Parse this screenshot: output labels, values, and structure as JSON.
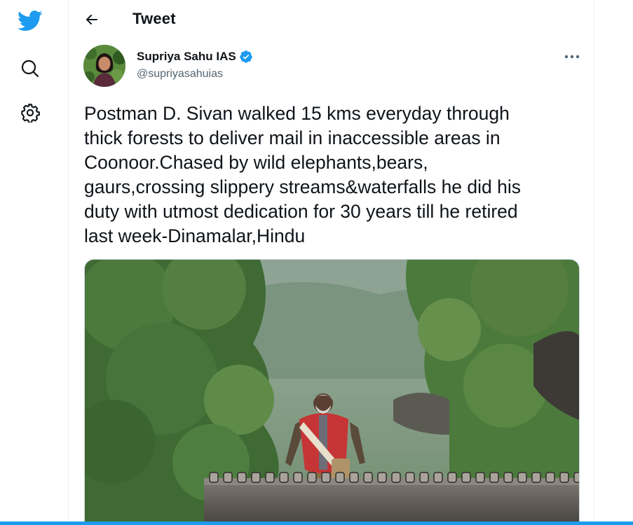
{
  "header": {
    "title": "Tweet"
  },
  "author": {
    "name": "Supriya Sahu IAS",
    "handle": "@supriyasahuias"
  },
  "tweet": {
    "text": "Postman D. Sivan walked 15 kms everyday through\nthick forests to deliver mail in inaccessible areas in\nCoonoor.Chased by wild elephants,bears,\ngaurs,crossing slippery streams&waterfalls he did his\nduty with utmost dedication for 30 years till he retired\nlast week-Dinamalar,Hindu"
  },
  "icons": {
    "logo": "twitter-bird-icon",
    "search": "search-icon",
    "settings": "gear-icon",
    "back": "arrow-left-icon",
    "verified": "verified-badge-icon",
    "more": "more-horizontal-icon"
  },
  "colors": {
    "brand": "#1d9bf0",
    "text": "#0f1419",
    "secondary": "#536471"
  }
}
